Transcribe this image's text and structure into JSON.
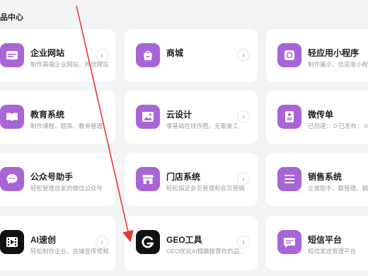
{
  "section": {
    "title": "品中心"
  },
  "arrow_glyph": "›",
  "cards": [
    {
      "title": "企业网站",
      "desc": "制作高端企业网站、外贸网站",
      "icon": "website-icon"
    },
    {
      "title": "商城",
      "desc": "",
      "icon": "shop-bag-icon"
    },
    {
      "title": "轻应用小程序",
      "desc": "制作展示、信息库小程序",
      "icon": "mini-program-icon"
    },
    {
      "title": "教育系统",
      "desc": "制作课程、题库、教务管理…",
      "icon": "book-icon"
    },
    {
      "title": "云设计",
      "desc": "零基础在线作图，无需美工",
      "icon": "image-icon"
    },
    {
      "title": "微传单",
      "desc": "已创建： 0    已发布： 0",
      "icon": "flyer-icon"
    },
    {
      "title": "公众号助手",
      "desc": "轻松管理自家的微信公众号",
      "icon": "chat-icon"
    },
    {
      "title": "门店系统",
      "desc": "轻松搞定会员管理和会员营销",
      "icon": "store-icon"
    },
    {
      "title": "销售系统",
      "desc": "企微助手、群管理、销售…",
      "icon": "list-icon"
    },
    {
      "title": "AI速创",
      "desc": "轻松制作企业、店铺宣传视频",
      "icon": "video-icon"
    },
    {
      "title": "GEO工具",
      "desc": "GEO优化AI精确推荐你的品…",
      "icon": "geo-logo-icon"
    },
    {
      "title": "短信平台",
      "desc": "短信发送管理平台",
      "icon": "sms-icon"
    }
  ]
}
